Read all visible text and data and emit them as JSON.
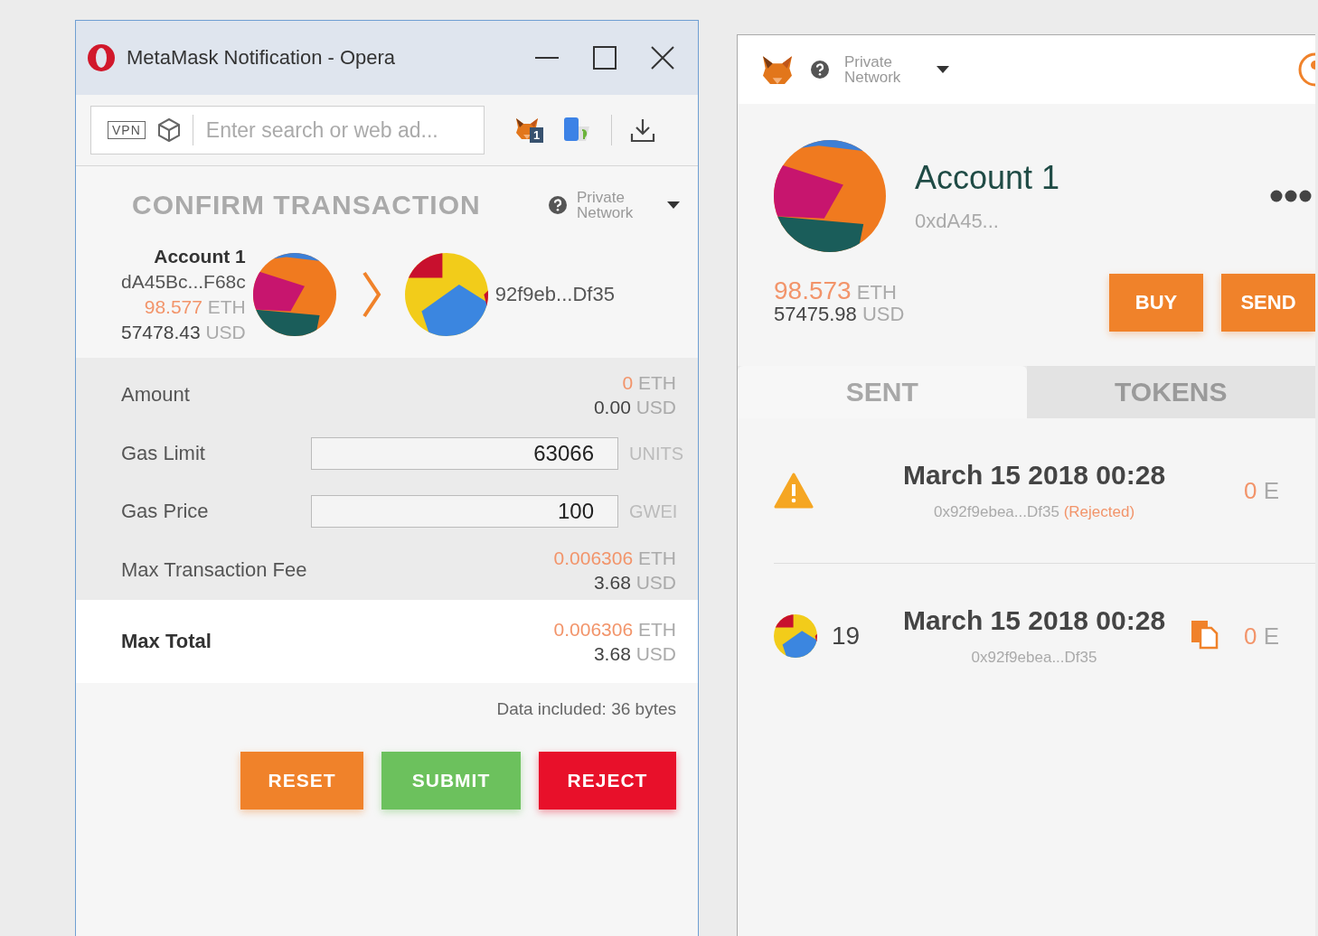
{
  "window": {
    "title": "MetaMask Notification - Opera"
  },
  "toolbar": {
    "vpn_badge": "VPN",
    "address_placeholder": "Enter search or web ad...",
    "extension_badge": "1"
  },
  "confirm": {
    "title": "CONFIRM TRANSACTION",
    "network": "Private Network",
    "from": {
      "name": "Account 1",
      "address": "dA45Bc...F68c",
      "eth": "98.577",
      "eth_unit": "ETH",
      "usd": "57478.43",
      "usd_unit": "USD"
    },
    "to": {
      "address": "92f9eb...Df35"
    },
    "rows": [
      {
        "kind": "amount",
        "label": "Amount",
        "eth": "0",
        "eth_unit": "ETH",
        "usd": "0.00",
        "usd_unit": "USD"
      },
      {
        "kind": "field",
        "label": "Gas Limit",
        "value": "63066",
        "unit": "UNITS"
      },
      {
        "kind": "field",
        "label": "Gas Price",
        "value": "100",
        "unit": "GWEI"
      },
      {
        "kind": "amount",
        "label": "Max Transaction Fee",
        "eth": "0.006306",
        "eth_unit": "ETH",
        "usd": "3.68",
        "usd_unit": "USD"
      },
      {
        "kind": "total",
        "label": "Max Total",
        "eth": "0.006306",
        "eth_unit": "ETH",
        "usd": "3.68",
        "usd_unit": "USD"
      }
    ],
    "data_note": "Data included: 36 bytes",
    "buttons": [
      {
        "label": "RESET",
        "color": "#f0822a"
      },
      {
        "label": "SUBMIT",
        "color": "#6cc15d"
      },
      {
        "label": "REJECT",
        "color": "#e8102a"
      }
    ]
  },
  "wallet": {
    "network": "Private Network",
    "account": {
      "name": "Account 1",
      "address": "0xdA45...",
      "eth": "98.573",
      "eth_unit": "ETH",
      "usd": "57475.98",
      "usd_unit": "USD"
    },
    "buttons": [
      "BUY",
      "SEND"
    ],
    "tabs": [
      {
        "label": "SENT",
        "selected": true
      },
      {
        "label": "TOKENS",
        "selected": false
      }
    ],
    "transactions": [
      {
        "kind": "rejected",
        "date": "March 15 2018 00:28",
        "address": "0x92f9ebea...Df35",
        "status": "(Rejected)",
        "amount": "0",
        "unit": "E"
      },
      {
        "kind": "contract",
        "nonce": "19",
        "date": "March 15 2018 00:28",
        "address": "0x92f9ebea...Df35",
        "amount": "0",
        "unit": "E"
      }
    ]
  }
}
